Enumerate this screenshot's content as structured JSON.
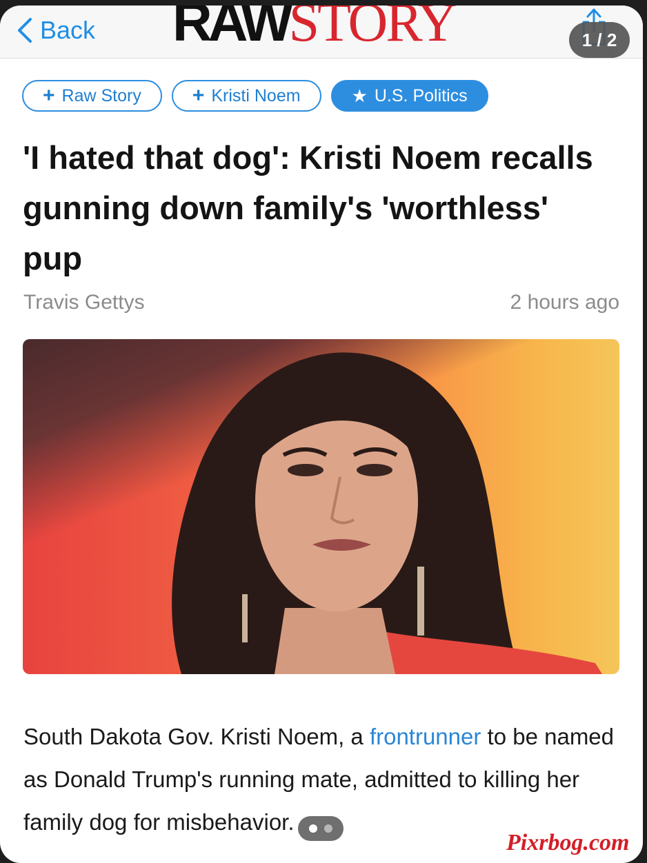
{
  "navbar": {
    "back_label": "Back",
    "logo_raw": "RAW",
    "logo_story": "STORY",
    "page_indicator": "1 / 2",
    "share_icon": "share-icon"
  },
  "chips": [
    {
      "symbol": "+",
      "label": "Raw Story",
      "active": false
    },
    {
      "symbol": "+",
      "label": "Kristi Noem",
      "active": false
    },
    {
      "symbol": "★",
      "label": "U.S. Politics",
      "active": true
    }
  ],
  "article": {
    "headline": "'I hated that dog': Kristi Noem recalls gunning down family's 'worthless' pup",
    "author": "Travis Gettys",
    "time": "2 hours ago",
    "body_before_link": "South Dakota Gov. Kristi Noem, a ",
    "body_link": "frontrunner",
    "body_after_link": " to be named as Donald Trump's running mate, admitted to killing her family dog for misbehavior."
  },
  "pager": {
    "total": 2,
    "current": 1
  },
  "watermark": "Pixrbog.com",
  "colors": {
    "accent": "#2d8ee0",
    "logo_red": "#d8262e",
    "text": "#141414",
    "muted": "#8b8b8b"
  }
}
